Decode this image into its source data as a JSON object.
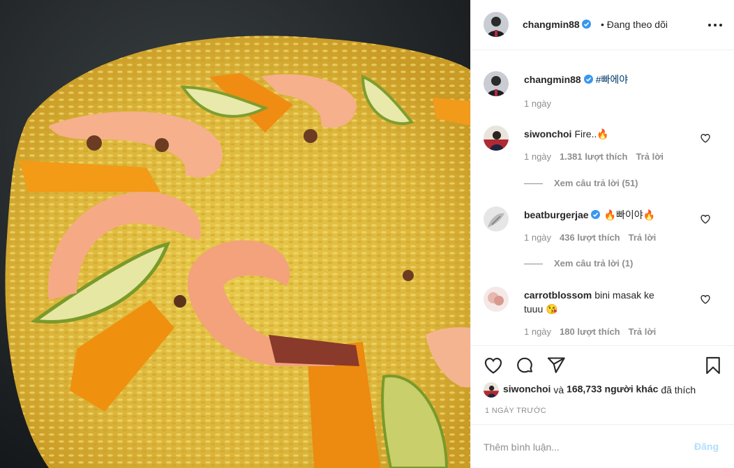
{
  "post": {
    "author": "changmin88",
    "follow_status": "• Đang theo dõi",
    "caption_user": "changmin88",
    "caption_text": "#빠에야",
    "caption_time": "1 ngày"
  },
  "comments": [
    {
      "user": "siwonchoi",
      "text": "Fire..🔥",
      "time": "1 ngày",
      "likes": "1.381 lượt thích",
      "reply": "Trả lời",
      "view_replies": "Xem câu trả lời (51)"
    },
    {
      "user": "beatburgerjae",
      "text": "🔥빠이야🔥",
      "time": "1 ngày",
      "likes": "436 lượt thích",
      "reply": "Trả lời",
      "view_replies": "Xem câu trả lời (1)"
    },
    {
      "user": "carrotblossom",
      "text": "bini masak ke tuuu 😘",
      "time": "1 ngày",
      "likes": "180 lượt thích",
      "reply": "Trả lời"
    }
  ],
  "liked_by": {
    "user": "siwonchoi",
    "and": "và",
    "count": "168,733 người khác",
    "suffix": "đã thích"
  },
  "post_time": "1 NGÀY TRƯỚC",
  "comment_input": {
    "placeholder": "Thêm bình luận...",
    "post_label": "Đăng"
  },
  "icons": {
    "more": "more-options-icon",
    "verified": "verified-badge-icon",
    "heart": "heart-icon",
    "comment": "comment-icon",
    "share": "share-icon",
    "save": "bookmark-icon"
  },
  "colors": {
    "verified": "#3897f0",
    "hashtag": "#00376b",
    "muted": "#8e8e8e",
    "post_button_disabled": "#b2dffc"
  }
}
